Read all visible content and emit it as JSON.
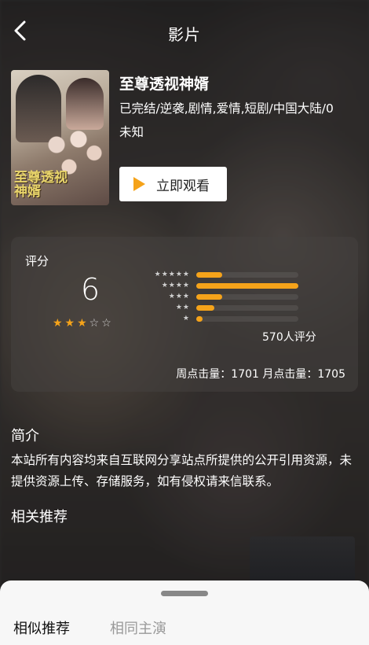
{
  "header": {
    "title": "影片"
  },
  "movie": {
    "title": "至尊透视神婿",
    "poster_title": "至尊透视神婿",
    "meta_line": "已完结/逆袭,剧情,爱情,短剧/中国大陆/0",
    "meta_line2": "未知",
    "watch_label": "立即观看"
  },
  "rating": {
    "label": "评分",
    "score": "6",
    "stars": {
      "on": "★★★",
      "off": "☆☆"
    },
    "distribution": [
      {
        "stars": "★★★★★",
        "fraction": 0.25
      },
      {
        "stars": "★★★★",
        "fraction": 1.0
      },
      {
        "stars": "★★★",
        "fraction": 0.25
      },
      {
        "stars": "★★",
        "fraction": 0.18
      },
      {
        "stars": "★",
        "fraction": 0.06
      }
    ],
    "count_text": "570人评分",
    "clicks_text": "周点击量：1701  月点击量：1705"
  },
  "intro": {
    "heading": "简介",
    "text": "本站所有内容均来自互联网分享站点所提供的公开引用资源，未提供资源上传、存储服务，如有侵权请来信联系。"
  },
  "related": {
    "heading": "相关推荐"
  },
  "bottom_sheet": {
    "tabs": [
      "相似推荐",
      "相同主演"
    ]
  },
  "colors": {
    "accent": "#f5a31a"
  }
}
